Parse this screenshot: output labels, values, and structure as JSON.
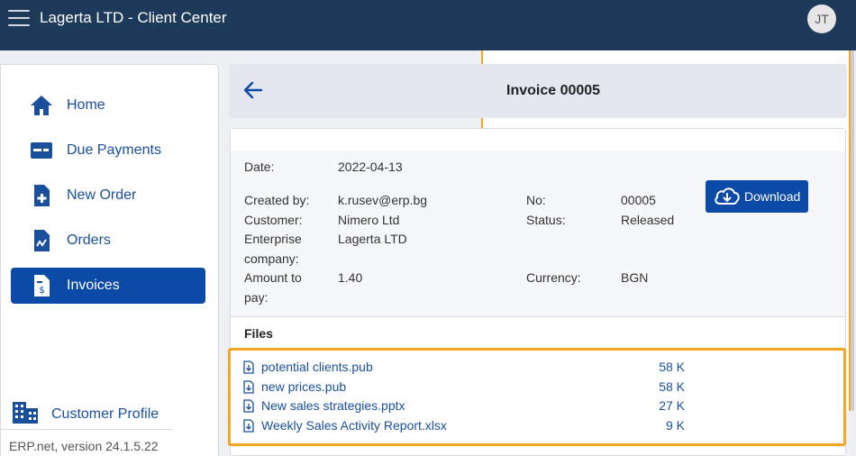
{
  "app": {
    "title": "Lagerta LTD - Client Center",
    "user_initials": "JT"
  },
  "sidebar": {
    "items": [
      {
        "label": "Home",
        "icon": "home-icon"
      },
      {
        "label": "Due Payments",
        "icon": "payment-card-icon"
      },
      {
        "label": "New Order",
        "icon": "new-document-icon"
      },
      {
        "label": "Orders",
        "icon": "orders-document-icon"
      },
      {
        "label": "Invoices",
        "icon": "invoice-document-icon",
        "active": true
      }
    ],
    "profile_label": "Customer Profile",
    "version": "ERP.net, version 24.1.5.22"
  },
  "invoice": {
    "title": "Invoice 00005",
    "download_label": "Download",
    "fields": {
      "date_label": "Date:",
      "date": "2022-04-13",
      "created_by_label": "Created by:",
      "created_by": "k.rusev@erp.bg",
      "customer_label": "Customer:",
      "customer": "Nimero Ltd",
      "enterprise_label_1": "Enterprise",
      "enterprise_label_2": "company:",
      "enterprise": "Lagerta LTD",
      "amount_label_1": "Amount to",
      "amount_label_2": "pay:",
      "amount": "1.40",
      "no_label": "No:",
      "no": "00005",
      "status_label": "Status:",
      "status": "Released",
      "currency_label": "Currency:",
      "currency": "BGN"
    },
    "files_title": "Files",
    "files": [
      {
        "name": "potential clients.pub",
        "size": "58 K"
      },
      {
        "name": "new prices.pub",
        "size": "58 K"
      },
      {
        "name": "New sales strategies.pptx",
        "size": "27 K"
      },
      {
        "name": "Weekly Sales Activity Report.xlsx",
        "size": "9 K"
      }
    ]
  },
  "colors": {
    "topbar": "#1e3a5a",
    "accent": "#0b4aa6",
    "link": "#1a4f9c",
    "highlight": "#f5a623"
  }
}
